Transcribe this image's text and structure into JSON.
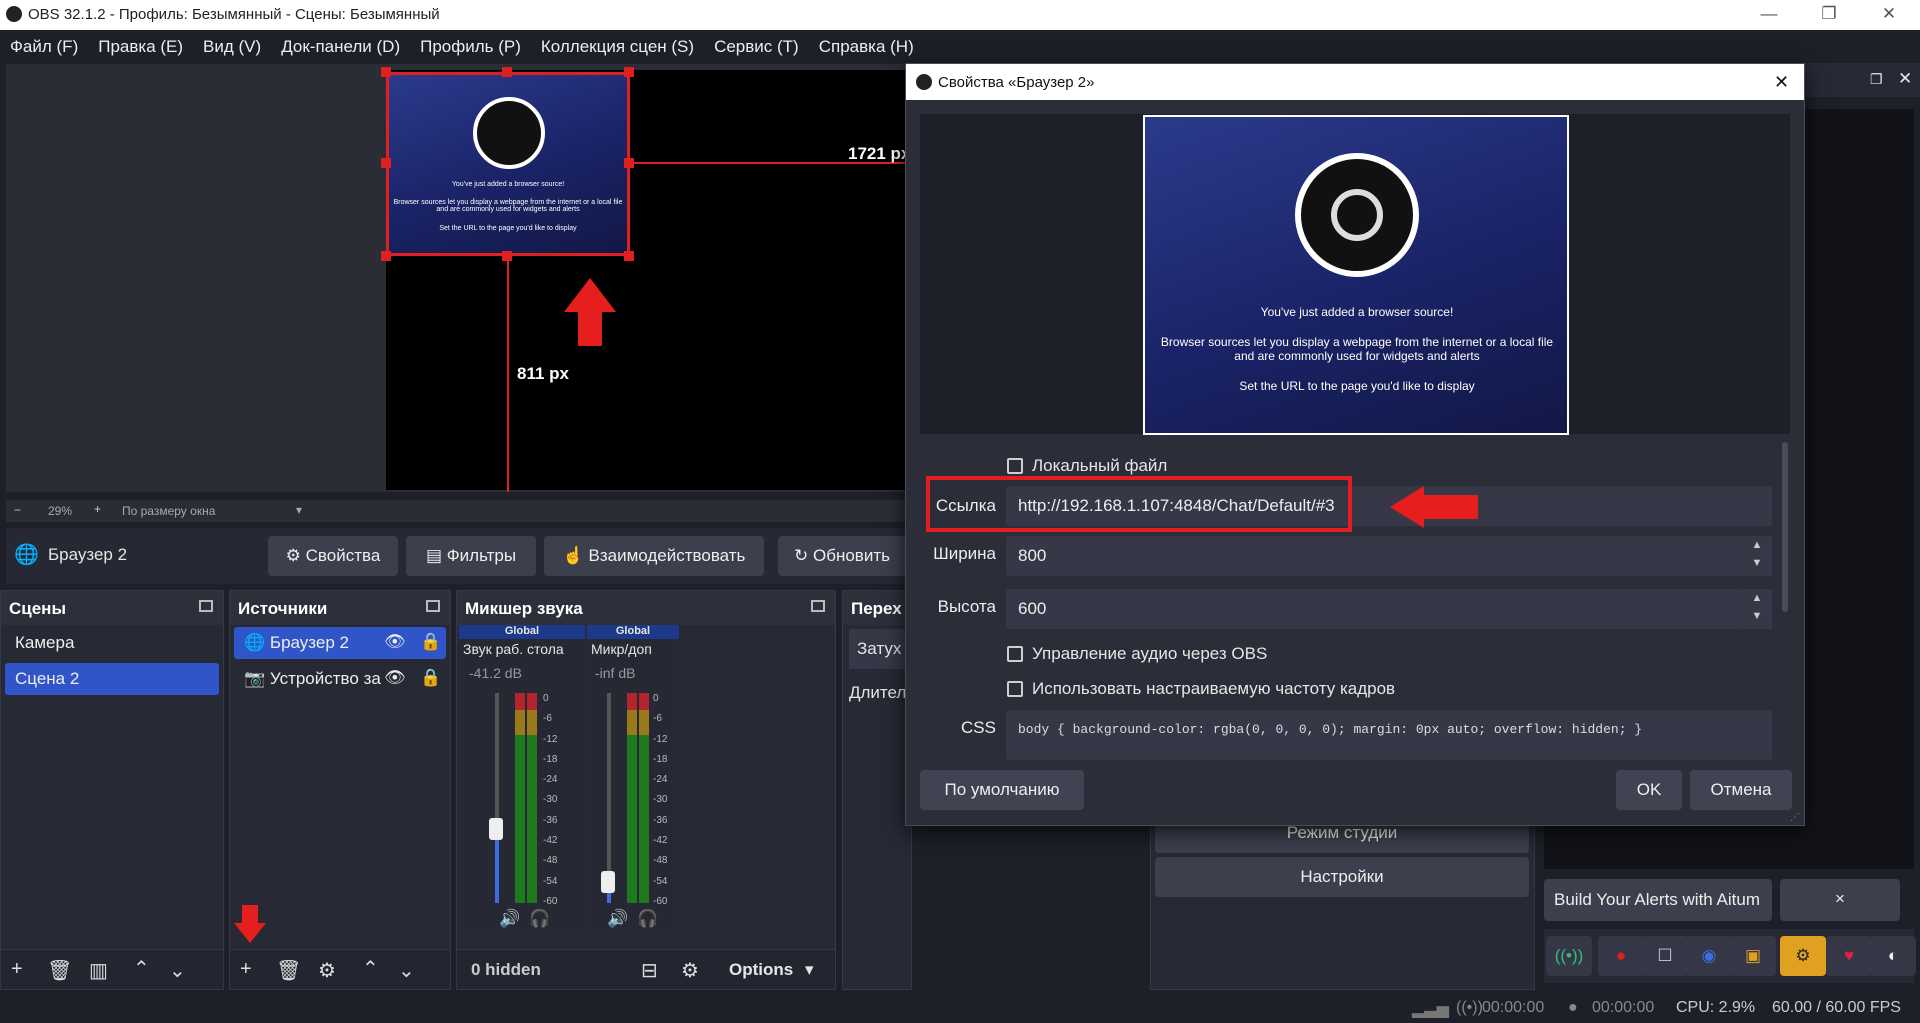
{
  "app": {
    "title": "OBS 32.1.2 - Профиль: Безымянный - Сцены: Безымянный"
  },
  "menu": [
    "Файл (F)",
    "Правка (E)",
    "Вид (V)",
    "Док-панели (D)",
    "Профиль (P)",
    "Коллекция сцен (S)",
    "Сервис (T)",
    "Справка (H)"
  ],
  "preview": {
    "width_label": "1721 px",
    "height_label": "811 px",
    "zoom": "29%",
    "zoom_mode": "По размеру окна",
    "thumb_line1": "You've just added a browser source!",
    "thumb_line2": "Browser sources let you display a webpage from the internet or a local file and are commonly used for widgets and alerts",
    "thumb_line3": "Set the URL to the page you'd like to display"
  },
  "source_bar": {
    "source_name": "Браузер 2",
    "properties": "Свойства",
    "filters": "Фильтры",
    "interact": "Взаимодействовать",
    "refresh": "Обновить"
  },
  "scenes": {
    "title": "Сцены",
    "items": [
      "Камера",
      "Сцена 2"
    ]
  },
  "sources": {
    "title": "Источники",
    "items": [
      "Браузер 2",
      "Устройство за"
    ]
  },
  "mixer": {
    "title": "Микшер звука",
    "channels": [
      {
        "tag": "Global",
        "name": "Звук раб. стола",
        "db": "-41.2 dB",
        "level": 0.35
      },
      {
        "tag": "Global",
        "name": "Микр/доп",
        "db": "-inf dB",
        "level": 0.1
      }
    ],
    "scale": [
      "0",
      "-6",
      "-12",
      "-18",
      "-24",
      "-30",
      "-36",
      "-42",
      "-48",
      "-54",
      "-60"
    ],
    "hidden": "0 hidden",
    "options": "Options"
  },
  "transitions": {
    "title": "Перех",
    "item1": "Затух",
    "item2": "Длител"
  },
  "controls": {
    "studio": "Режим студии",
    "settings": "Настройки"
  },
  "aitum": {
    "build": "Build Your Alerts with Aitum",
    "close": "×"
  },
  "dialog": {
    "title": "Свойства «Браузер 2»",
    "local_file": "Локальный файл",
    "url_label": "Ссылка",
    "url_value": "http://192.168.1.107:4848/Chat/Default/#3",
    "width_label": "Ширина",
    "width_value": "800",
    "height_label": "Высота",
    "height_value": "600",
    "audio_control": "Управление аудио через OBS",
    "custom_fps": "Использовать настраиваемую частоту кадров",
    "css_label": "CSS",
    "css_value": "body { background-color: rgba(0, 0, 0, 0); margin: 0px auto; overflow: hidden; }",
    "preview_line1": "You've just added a browser source!",
    "preview_line2": "Browser sources let you display a webpage from the internet or a local file and are commonly used for widgets and alerts",
    "preview_line3": "Set the URL to the page you'd like to display",
    "defaults": "По умолчанию",
    "ok": "OK",
    "cancel": "Отмена"
  },
  "status": {
    "rec_time": "00:00:00",
    "stream_time": "00:00:00",
    "cpu": "CPU: 2.9%",
    "fps": "60.00 / 60.00 FPS"
  },
  "colors": {
    "accent": "#2f55c8",
    "highlight": "#e02020"
  }
}
